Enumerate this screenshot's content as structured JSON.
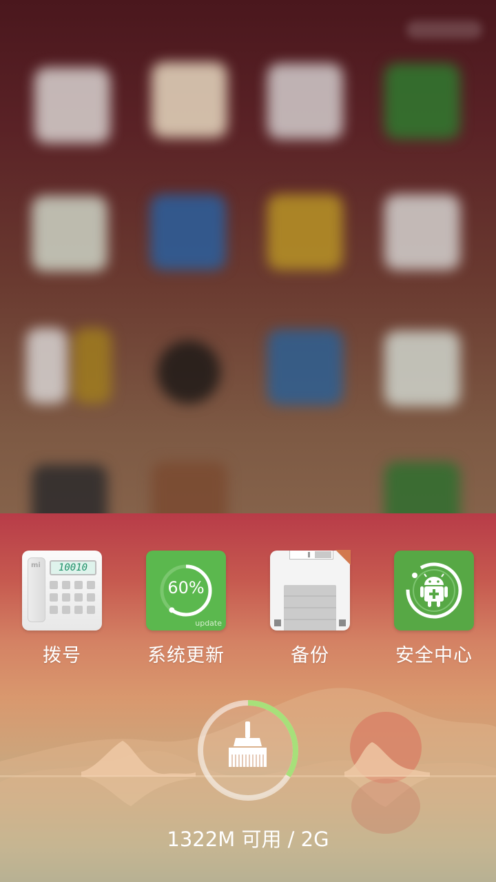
{
  "apps": [
    {
      "label": "拨号",
      "icon": "phone-dialer-icon"
    },
    {
      "label": "系统更新",
      "icon": "system-update-icon"
    },
    {
      "label": "备份",
      "icon": "floppy-backup-icon"
    },
    {
      "label": "安全中心",
      "icon": "security-center-icon"
    }
  ],
  "dialer_display": "10010",
  "dialer_brand": "mi",
  "update": {
    "percent_text": "60%",
    "progress": 0.6,
    "sub": "update"
  },
  "memory": {
    "text": "1322M 可用 / 2G",
    "used_fraction": 0.34
  },
  "colors": {
    "green": "#5bb84e",
    "accent_ring": "#a7e07a"
  }
}
